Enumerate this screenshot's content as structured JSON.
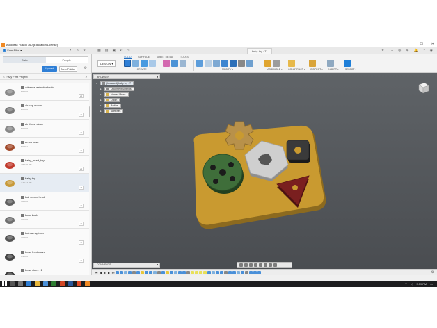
{
  "window": {
    "title": "Autodesk Fusion 360 (Education License)"
  },
  "appbar": {
    "user": "Sam Allen",
    "doc_tab": "baby toy v7*"
  },
  "data_panel": {
    "tabs": [
      "Data",
      "People"
    ],
    "upload_label": "Upload",
    "new_folder_label": "New Folder",
    "project": "My First Project",
    "files": [
      {
        "name": "advance extruder knob",
        "version": "6/27/20",
        "badge": "v1",
        "thumb_color": "#8a8a8a"
      },
      {
        "name": "air cap crown",
        "version": "6/14/20",
        "badge": "v1",
        "thumb_color": "#7a7a7a"
      },
      {
        "name": "air throw class",
        "version": "6/14/20",
        "badge": "v1",
        "thumb_color": "#888888"
      },
      {
        "name": "arrow vase",
        "version": "6/18/21",
        "badge": "v1",
        "thumb_color": "#a24a2b"
      },
      {
        "name": "baby_heart_toy",
        "version": "4:57:39 PM",
        "badge": "v1",
        "thumb_color": "#c0392b"
      },
      {
        "name": "baby toy",
        "version": "4:42:47 PM",
        "badge": "v7",
        "thumb_color": "#c89a3a"
      },
      {
        "name": "ball control knob",
        "version": "3/28/20",
        "badge": "v1",
        "thumb_color": "#606060"
      },
      {
        "name": "base knob",
        "version": "3/16/20",
        "badge": "v1",
        "thumb_color": "#6f6f6f"
      },
      {
        "name": "batman spinner",
        "version": "7/18/20",
        "badge": "v1",
        "thumb_color": "#555555"
      },
      {
        "name": "bead front curve",
        "version": "6/28/20",
        "badge": "v1",
        "thumb_color": "#444444"
      },
      {
        "name": "bead sides v1",
        "version": "",
        "badge": "v1",
        "thumb_color": "#3a3a3a"
      }
    ]
  },
  "toolbar": {
    "workspace": "DESIGN ▾",
    "tabs": [
      "SOLID",
      "SURFACE",
      "SHEET METAL",
      "TOOLS"
    ],
    "active_tab": "SOLID",
    "groups": [
      "CREATE ▾",
      "MODIFY ▾",
      "ASSEMBLE ▾",
      "CONSTRUCT ▾",
      "INSPECT ▾",
      "INSERT ▾",
      "SELECT ▾"
    ]
  },
  "browser": {
    "title": "BROWSER",
    "root": "(Unsaved) baby toy v7",
    "items": [
      "Document Settings",
      "Named Views",
      "Origin",
      "Bodies",
      "Sketches"
    ]
  },
  "comments": {
    "title": "COMMENTS"
  },
  "taskbar": {
    "time": "9:09 PM",
    "date": ""
  },
  "colors": {
    "accent": "#2f7fd6",
    "board": "#c99a30",
    "gear": "#b8914a",
    "green_disc": "#3f6e3a",
    "hexagon": "#bdbdbd",
    "square": "#2f2f2f",
    "triangle": "#7a1f1f",
    "viewport_bg": "#565a5e"
  }
}
